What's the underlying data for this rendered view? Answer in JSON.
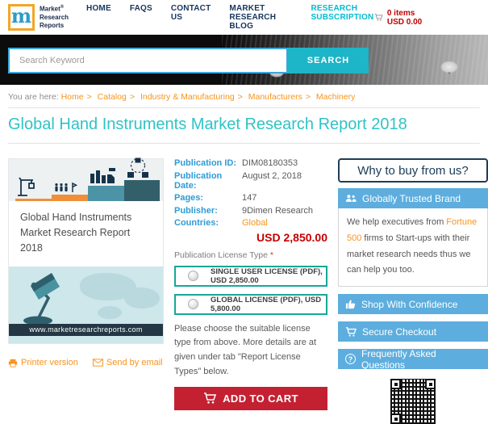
{
  "header": {
    "logo": {
      "letter": "m",
      "brand1": "Market",
      "reg": "®",
      "brand2": "Research",
      "brand3": "Reports"
    },
    "nav": [
      {
        "label": "HOME"
      },
      {
        "label": "FAQS"
      },
      {
        "label": "CONTACT US"
      },
      {
        "label": "MARKET RESEARCH BLOG"
      },
      {
        "label": "RESEARCH SUBSCRIPTION"
      }
    ],
    "cart": {
      "label": "0 items USD 0.00",
      "icon": "cart-icon"
    }
  },
  "search": {
    "placeholder": "Search Keyword",
    "button": "SEARCH"
  },
  "breadcrumb": {
    "prefix": "You are here:",
    "separator": ">",
    "items": [
      "Home",
      "Catalog",
      "Industry & Manufacturing",
      "Manufacturers",
      "Machinery"
    ]
  },
  "page": {
    "title": "Global Hand Instruments Market Research Report 2018"
  },
  "cover": {
    "title": "Global Hand Instruments Market Research Report 2018",
    "website": "www.marketresearchreports.com",
    "icons": [
      "crane-icon",
      "people-icon",
      "machinery-icon",
      "network-icon",
      "lamp-icon",
      "world-map"
    ]
  },
  "details": {
    "rows": [
      {
        "label": "Publication ID:",
        "value": "DIM08180353"
      },
      {
        "label": "Publication Date:",
        "value": "August 2, 2018"
      },
      {
        "label": "Pages:",
        "value": "147"
      },
      {
        "label": "Publisher:",
        "value": "9Dimen Research"
      },
      {
        "label": "Countries:",
        "value": "Global"
      }
    ],
    "price": "USD 2,850.00",
    "license_heading": "Publication License Type ",
    "required_mark": "*",
    "licenses": [
      {
        "label": "SINGLE USER LICENSE (PDF), USD 2,850.00"
      },
      {
        "label": "GLOBAL LICENSE (PDF), USD 5,800.00"
      }
    ],
    "note": "Please choose the suitable license type from above. More details are at given under tab \"Report License Types\" below.",
    "add_to_cart": "ADD TO CART",
    "add_to_cart_icon": "cart-icon"
  },
  "sidebar": {
    "heading": "Why to buy from us?",
    "bars": [
      {
        "label": "Globally Trusted Brand",
        "icon": "users-icon"
      },
      {
        "label": "Shop With Confidence",
        "icon": "thumbs-up-icon"
      },
      {
        "label": "Secure Checkout",
        "icon": "cart-icon"
      },
      {
        "label": "Frequently Asked Questions",
        "icon": "question-icon",
        "glyph": "?"
      }
    ],
    "trusted": {
      "pre": "We help executives from ",
      "highlight": "Fortune 500",
      "post": " firms to Start-ups with their market research needs thus we can help you too."
    },
    "qr": "qr-code"
  },
  "footer_links": [
    {
      "label": "Printer version",
      "icon": "printer-icon"
    },
    {
      "label": "Send by email",
      "icon": "email-icon"
    }
  ],
  "colors": {
    "accent_teal": "#2fc3c5",
    "accent_orange": "#f7941d",
    "price_red": "#c40000",
    "button_red": "#c32131",
    "bar_blue": "#5daede",
    "label_blue": "#2e9bd5",
    "search_teal": "#1db5c8",
    "license_border": "#17a896"
  }
}
